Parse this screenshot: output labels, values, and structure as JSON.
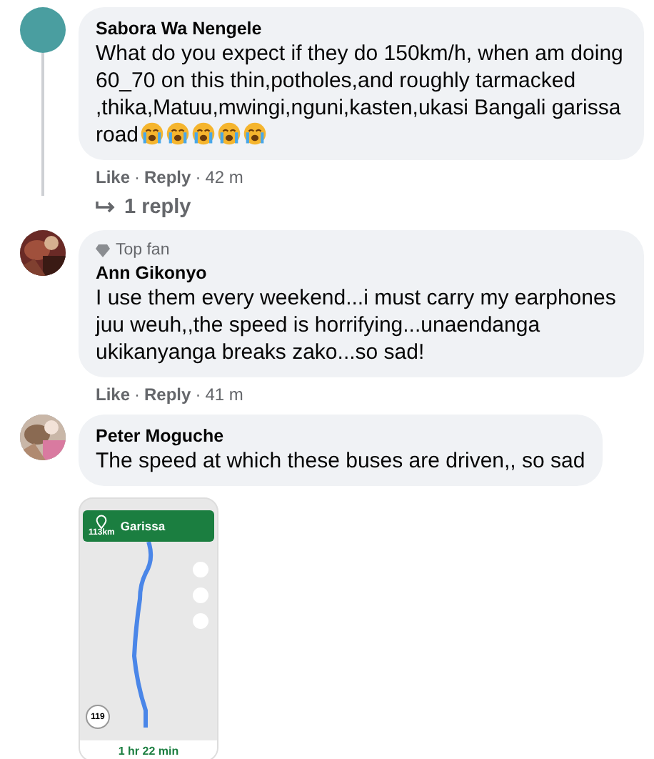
{
  "comments": [
    {
      "author": "Sabora Wa Nengele",
      "avatar": {
        "kind": "plain"
      },
      "text": "What do you expect if they do 150km/h, when am doing 60_70 on this thin,potholes,and roughly tarmacked ,thika,Matuu,mwingi,nguni,kasten,ukasi Bangali garissa road",
      "emojis": [
        {
          "kind": "crying"
        },
        {
          "kind": "crying"
        },
        {
          "kind": "crying"
        },
        {
          "kind": "crying"
        },
        {
          "kind": "crying"
        }
      ],
      "actions": [
        {
          "kind": "link",
          "text": "Like"
        },
        {
          "kind": "sep",
          "text": "·"
        },
        {
          "kind": "link",
          "text": "Reply"
        },
        {
          "kind": "sep",
          "text": "·"
        },
        {
          "kind": "time",
          "text": "42 m"
        }
      ],
      "replies_link": "1 reply"
    },
    {
      "author": "Ann Gikonyo",
      "badge": "Top fan",
      "text": "I use them every weekend...i must carry my earphones juu weuh,,the speed is horrifying...unaendanga ukikanyanga breaks zako...so sad!",
      "actions": [
        {
          "kind": "link",
          "text": "Like"
        },
        {
          "kind": "sep",
          "text": "·"
        },
        {
          "kind": "link",
          "text": "Reply"
        },
        {
          "kind": "sep",
          "text": "·"
        },
        {
          "kind": "time",
          "text": "41 m"
        }
      ]
    },
    {
      "author": "Peter Moguche",
      "text": "The speed at which these buses are driven,, so sad",
      "attachment": {
        "kind": "map_screenshot",
        "destination": "Garissa",
        "distance": "113",
        "distance_unit": "km",
        "speed_limit": "119",
        "eta": "1 hr 22 min"
      }
    }
  ]
}
